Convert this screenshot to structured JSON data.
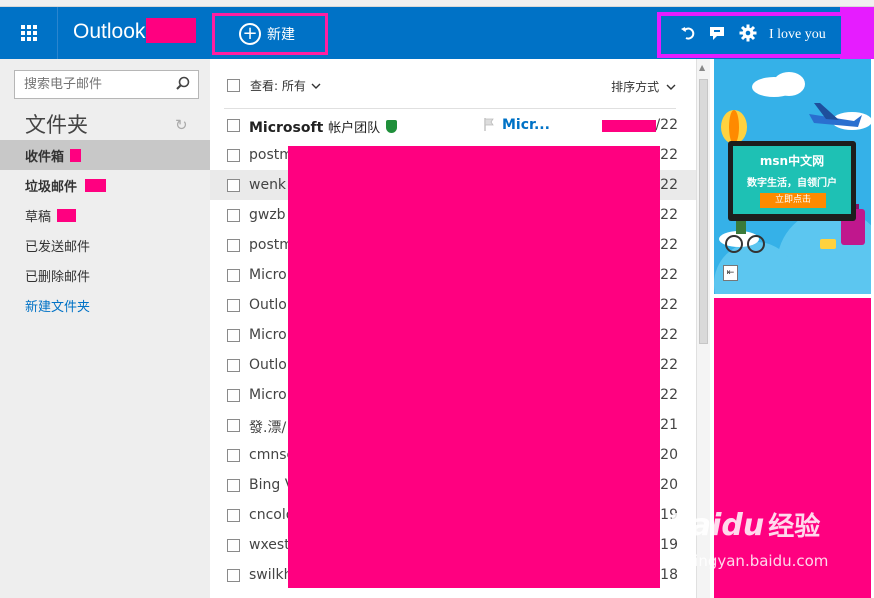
{
  "header": {
    "brand": "Outlook",
    "new_button_label": "新建",
    "user_name": "I love you",
    "icons": [
      "undo-icon",
      "chat-icon",
      "gear-icon"
    ]
  },
  "sidebar": {
    "search_placeholder": "搜索电子邮件",
    "folders_title": "文件夹",
    "items": [
      {
        "label": "收件箱"
      },
      {
        "label": "垃圾邮件"
      },
      {
        "label": "草稿"
      },
      {
        "label": "已发送邮件"
      },
      {
        "label": "已删除邮件"
      },
      {
        "label": "新建文件夹"
      }
    ]
  },
  "list": {
    "filter_label": "查看: 所有",
    "sort_label": "排序方式",
    "rows": [
      {
        "sender": "Microsoft",
        "sender_extra": "帐户团队",
        "subject": "Micr...",
        "date": "/22"
      },
      {
        "sender": "postm",
        "date": "22"
      },
      {
        "sender": "wenk",
        "date": "22"
      },
      {
        "sender": "gwzb",
        "date": "22"
      },
      {
        "sender": "postm",
        "date": "22"
      },
      {
        "sender": "Micro",
        "date": "22"
      },
      {
        "sender": "Outlo",
        "date": "22"
      },
      {
        "sender": "Micro",
        "date": "22"
      },
      {
        "sender": "Outlo",
        "date": "22"
      },
      {
        "sender": "Micro",
        "date": "22"
      },
      {
        "sender": "發.漂/",
        "date": "21"
      },
      {
        "sender": "cmnsc",
        "date": "20"
      },
      {
        "sender": "Bing V",
        "date": "20"
      },
      {
        "sender": "cncolo",
        "date": "19"
      },
      {
        "sender": "wxesti",
        "date": "19"
      },
      {
        "sender": "swilkh",
        "date": "18"
      }
    ]
  },
  "ad": {
    "brand": "msn中文网",
    "tagline": "数字生活，自领门户",
    "button": "立即点击"
  },
  "watermark": {
    "main": "Baidu",
    "cn": "经验",
    "url": "jingyan.baidu.com"
  },
  "colors": {
    "accent": "#0072c6",
    "redaction": "#ff0080",
    "highlight_border": "#e61cff"
  }
}
